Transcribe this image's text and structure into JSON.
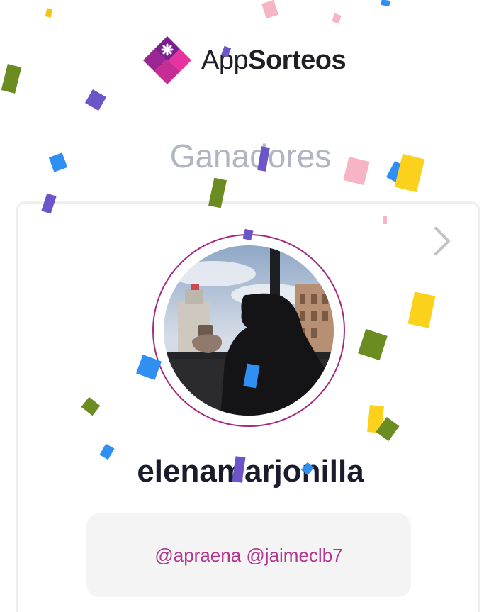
{
  "brand": {
    "name_light": "App",
    "name_bold": "Sorteos"
  },
  "title": "Ganadores",
  "winner": {
    "username": "elenamarjonilla",
    "mentions": "@apraena @jaimeclb7"
  },
  "colors": {
    "title": "#b1b5c2",
    "accent": "#a6287f",
    "mentions": "#b2378f",
    "username": "#1a1c2c"
  },
  "icons": {
    "logo": "appsorteos-logo-icon",
    "next": "chevron-right-icon",
    "avatar": "winner-avatar"
  }
}
